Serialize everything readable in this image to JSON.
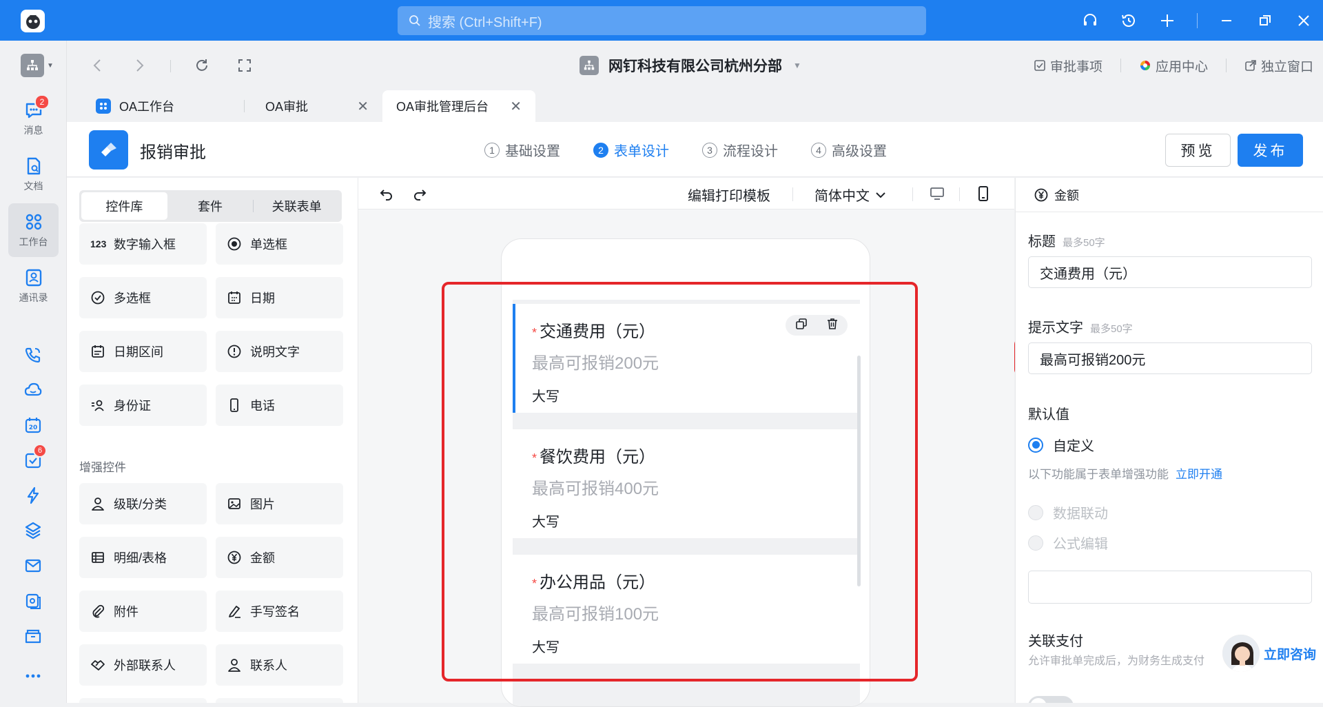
{
  "titlebar": {
    "search_placeholder": "搜索 (Ctrl+Shift+F)"
  },
  "sidebar": {
    "items": [
      {
        "label": "消息",
        "badge": "2"
      },
      {
        "label": "文档"
      },
      {
        "label": "工作台"
      },
      {
        "label": "通讯录"
      }
    ],
    "todo_badge": "6"
  },
  "navbar": {
    "org_name": "网钉科技有限公司杭州分部",
    "links": [
      "审批事项",
      "应用中心",
      "独立窗口"
    ]
  },
  "tabs": [
    {
      "label": "OA工作台"
    },
    {
      "label": "OA审批"
    },
    {
      "label": "OA审批管理后台"
    }
  ],
  "header": {
    "title": "报销审批",
    "steps": [
      {
        "num": "1",
        "label": "基础设置"
      },
      {
        "num": "2",
        "label": "表单设计"
      },
      {
        "num": "3",
        "label": "流程设计"
      },
      {
        "num": "4",
        "label": "高级设置"
      }
    ],
    "preview_label": "预览",
    "publish_label": "发布"
  },
  "library": {
    "tabs": [
      "控件库",
      "套件",
      "关联表单"
    ],
    "controls": [
      "数字输入框",
      "单选框",
      "多选框",
      "日期",
      "日期区间",
      "说明文字",
      "身份证",
      "电话"
    ],
    "section_title": "增强控件",
    "enhanced": [
      "级联/分类",
      "图片",
      "明细/表格",
      "金额",
      "附件",
      "手写签名",
      "外部联系人",
      "联系人"
    ]
  },
  "canvas": {
    "print_template": "编辑打印模板",
    "language": "简体中文",
    "fields": [
      {
        "title": "交通费用（元）",
        "placeholder": "最高可报销200元",
        "caps": "大写"
      },
      {
        "title": "餐饮费用（元）",
        "placeholder": "最高可报销400元",
        "caps": "大写"
      },
      {
        "title": "办公用品（元）",
        "placeholder": "最高可报销100元",
        "caps": "大写"
      }
    ]
  },
  "props": {
    "header": "金额",
    "title_label": "标题",
    "title_hint": "最多50字",
    "title_value": "交通费用（元）",
    "hint_label": "提示文字",
    "hint_hint": "最多50字",
    "hint_value": "最高可报销200元",
    "default_label": "默认值",
    "custom_option": "自定义",
    "enhance_note": "以下功能属于表单增强功能",
    "enhance_link": "立即开通",
    "data_link_option": "数据联动",
    "formula_option": "公式编辑",
    "pay_label": "关联支付",
    "pay_note": "允许审批单完成后，为财务生成支付"
  },
  "consult": {
    "label": "立即咨询"
  },
  "colors": {
    "brand": "#1e7ff0",
    "highlight": "#e5262a",
    "required": "#f54a45"
  }
}
